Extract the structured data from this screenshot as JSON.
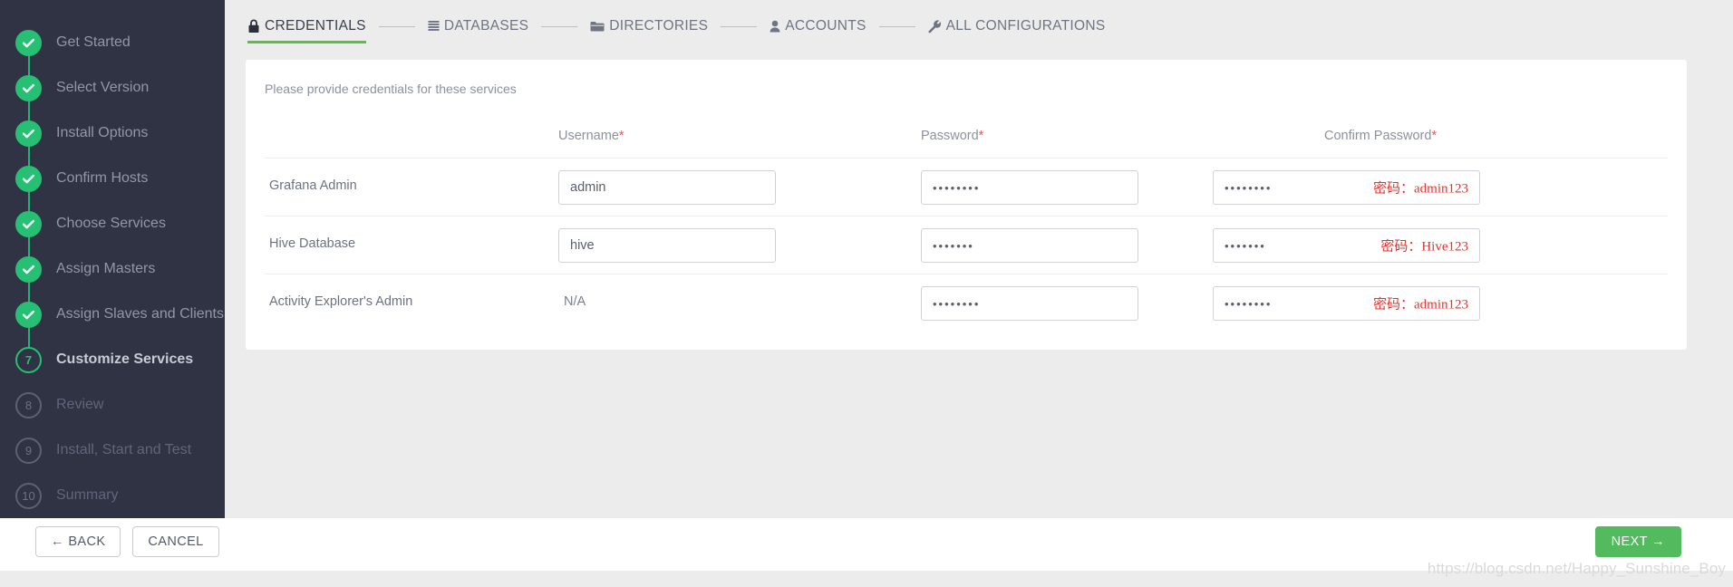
{
  "sidebar": {
    "items": [
      {
        "badge": "check",
        "label": "Get Started",
        "state": "done"
      },
      {
        "badge": "check",
        "label": "Select Version",
        "state": "done"
      },
      {
        "badge": "check",
        "label": "Install Options",
        "state": "done"
      },
      {
        "badge": "check",
        "label": "Confirm Hosts",
        "state": "done"
      },
      {
        "badge": "check",
        "label": "Choose Services",
        "state": "done"
      },
      {
        "badge": "check",
        "label": "Assign Masters",
        "state": "done"
      },
      {
        "badge": "check",
        "label": "Assign Slaves and Clients",
        "state": "done"
      },
      {
        "badge": "7",
        "label": "Customize Services",
        "state": "current"
      },
      {
        "badge": "8",
        "label": "Review",
        "state": "todo"
      },
      {
        "badge": "9",
        "label": "Install, Start and Test",
        "state": "todo"
      },
      {
        "badge": "10",
        "label": "Summary",
        "state": "todo"
      }
    ]
  },
  "tabs": [
    {
      "label": "CREDENTIALS",
      "icon": "lock-icon",
      "active": true
    },
    {
      "label": "DATABASES",
      "icon": "database-icon",
      "active": false
    },
    {
      "label": "DIRECTORIES",
      "icon": "folder-icon",
      "active": false
    },
    {
      "label": "ACCOUNTS",
      "icon": "user-icon",
      "active": false
    },
    {
      "label": "ALL CONFIGURATIONS",
      "icon": "wrench-icon",
      "active": false
    }
  ],
  "card": {
    "note": "Please provide credentials for these services",
    "columns": {
      "service": "",
      "username": "Username",
      "password": "Password",
      "confirm": "Confirm Password",
      "required_mark": "*"
    },
    "rows": [
      {
        "service": "Grafana Admin",
        "username": "admin",
        "username_is_na": false,
        "password": "••••••••",
        "confirm": "••••••••",
        "annotation": "密码：admin123"
      },
      {
        "service": "Hive Database",
        "username": "hive",
        "username_is_na": false,
        "password": "•••••••",
        "confirm": "•••••••",
        "annotation": "密码：Hive123"
      },
      {
        "service": "Activity Explorer's Admin",
        "username": "N/A",
        "username_is_na": true,
        "password": "••••••••",
        "confirm": "••••••••",
        "annotation": "密码：admin123"
      }
    ]
  },
  "footer": {
    "back_label": "← BACK",
    "cancel_label": "CANCEL",
    "next_label": "NEXT →"
  },
  "watermark": "https://blog.csdn.net/Happy_Sunshine_Boy",
  "colors": {
    "sidebar_bg": "#2f3343",
    "accent_green": "#27bf73",
    "tab_underline": "#57c140",
    "next_button": "#53bb5d",
    "annotation_red": "#e8322e",
    "required_red": "#e05c5c"
  }
}
